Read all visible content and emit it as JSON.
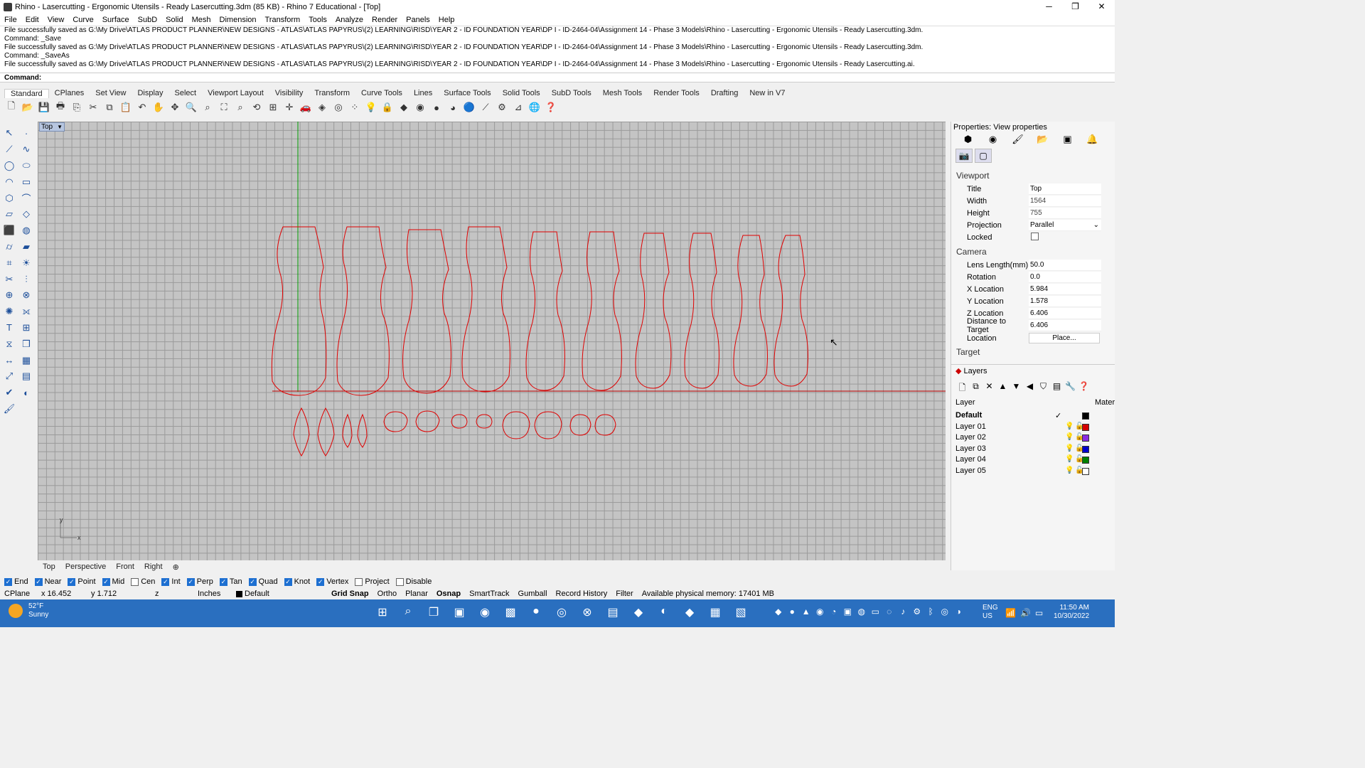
{
  "window": {
    "title": "Rhino - Lasercutting - Ergonomic Utensils - Ready Lasercutting.3dm (85 KB) - Rhino 7 Educational - [Top]",
    "minimize": "─",
    "maximize": "❐",
    "close": "✕"
  },
  "menu": [
    "File",
    "Edit",
    "View",
    "Curve",
    "Surface",
    "SubD",
    "Solid",
    "Mesh",
    "Dimension",
    "Transform",
    "Tools",
    "Analyze",
    "Render",
    "Panels",
    "Help"
  ],
  "command_history": [
    "File successfully saved as G:\\My Drive\\ATLAS PRODUCT PLANNER\\NEW DESIGNS - ATLAS\\ATLAS PAPYRUS\\(2) LEARNING\\RISD\\YEAR 2 - ID FOUNDATION YEAR\\DP I - ID-2464-04\\Assignment 14 - Phase 3 Models\\Rhino - Lasercutting - Ergonomic Utensils - Ready Lasercutting.3dm.",
    "Command: _Save",
    "File successfully saved as G:\\My Drive\\ATLAS PRODUCT PLANNER\\NEW DESIGNS - ATLAS\\ATLAS PAPYRUS\\(2) LEARNING\\RISD\\YEAR 2 - ID FOUNDATION YEAR\\DP I - ID-2464-04\\Assignment 14 - Phase 3 Models\\Rhino - Lasercutting - Ergonomic Utensils - Ready Lasercutting.3dm.",
    "Command: _SaveAs",
    "File successfully saved as G:\\My Drive\\ATLAS PRODUCT PLANNER\\NEW DESIGNS - ATLAS\\ATLAS PAPYRUS\\(2) LEARNING\\RISD\\YEAR 2 - ID FOUNDATION YEAR\\DP I - ID-2464-04\\Assignment 14 - Phase 3 Models\\Rhino - Lasercutting - Ergonomic Utensils - Ready Lasercutting.ai."
  ],
  "command_prompt": "Command:",
  "toolbar_tabs": [
    "Standard",
    "CPlanes",
    "Set View",
    "Display",
    "Select",
    "Viewport Layout",
    "Visibility",
    "Transform",
    "Curve Tools",
    "Lines",
    "Surface Tools",
    "Solid Tools",
    "SubD Tools",
    "Mesh Tools",
    "Render Tools",
    "Drafting",
    "New in V7"
  ],
  "viewport": {
    "name": "Top",
    "axis_y": "y",
    "axis_x": "x",
    "tabs": [
      "Top",
      "Perspective",
      "Front",
      "Right",
      "⊕"
    ]
  },
  "osnap": [
    {
      "label": "End",
      "on": true
    },
    {
      "label": "Near",
      "on": true
    },
    {
      "label": "Point",
      "on": true
    },
    {
      "label": "Mid",
      "on": true
    },
    {
      "label": "Cen",
      "on": false
    },
    {
      "label": "Int",
      "on": true
    },
    {
      "label": "Perp",
      "on": true
    },
    {
      "label": "Tan",
      "on": true
    },
    {
      "label": "Quad",
      "on": true
    },
    {
      "label": "Knot",
      "on": true
    },
    {
      "label": "Vertex",
      "on": true
    },
    {
      "label": "Project",
      "on": false
    },
    {
      "label": "Disable",
      "on": false
    }
  ],
  "status": {
    "cplane": "CPlane",
    "x": "x 16.452",
    "y": "y 1.712",
    "z": "z",
    "units": "Inches",
    "layer": "Default",
    "grid_snap": "Grid Snap",
    "ortho": "Ortho",
    "planar": "Planar",
    "osnap": "Osnap",
    "smarttrack": "SmartTrack",
    "gumball": "Gumball",
    "record_history": "Record History",
    "filter": "Filter",
    "memory": "Available physical memory: 17401 MB"
  },
  "properties": {
    "title": "Properties: View properties",
    "viewport_section": "Viewport",
    "camera_section": "Camera",
    "target_section": "Target",
    "rows": [
      {
        "k": "Title",
        "v": "Top"
      },
      {
        "k": "Width",
        "v": "1564"
      },
      {
        "k": "Height",
        "v": "755"
      },
      {
        "k": "Projection",
        "v": "Parallel"
      },
      {
        "k": "Locked",
        "v": ""
      }
    ],
    "camera_rows": [
      {
        "k": "Lens Length(mm)",
        "v": "50.0"
      },
      {
        "k": "Rotation",
        "v": "0.0"
      },
      {
        "k": "X Location",
        "v": "5.984"
      },
      {
        "k": "Y Location",
        "v": "1.578"
      },
      {
        "k": "Z Location",
        "v": "6.406"
      },
      {
        "k": "Distance to Target",
        "v": "6.406"
      },
      {
        "k": "Location",
        "v": "Place..."
      }
    ]
  },
  "layers": {
    "title": "Layers",
    "col_layer": "Layer",
    "col_material": "Mater",
    "rows": [
      {
        "name": "Default",
        "color": "#000000",
        "current": true
      },
      {
        "name": "Layer 01",
        "color": "#d40000"
      },
      {
        "name": "Layer 02",
        "color": "#8a2be2"
      },
      {
        "name": "Layer 03",
        "color": "#0000cc"
      },
      {
        "name": "Layer 04",
        "color": "#008000"
      },
      {
        "name": "Layer 05",
        "color": "#ffffff"
      }
    ]
  },
  "taskbar": {
    "temp": "52°F",
    "weather": "Sunny",
    "lang1": "ENG",
    "lang2": "US",
    "time": "11:50 AM",
    "date": "10/30/2022"
  },
  "colors": {
    "curve": "#e00000",
    "axis_x": "#c00000",
    "axis_y": "#009a00",
    "taskbar": "#2a6fbf"
  }
}
